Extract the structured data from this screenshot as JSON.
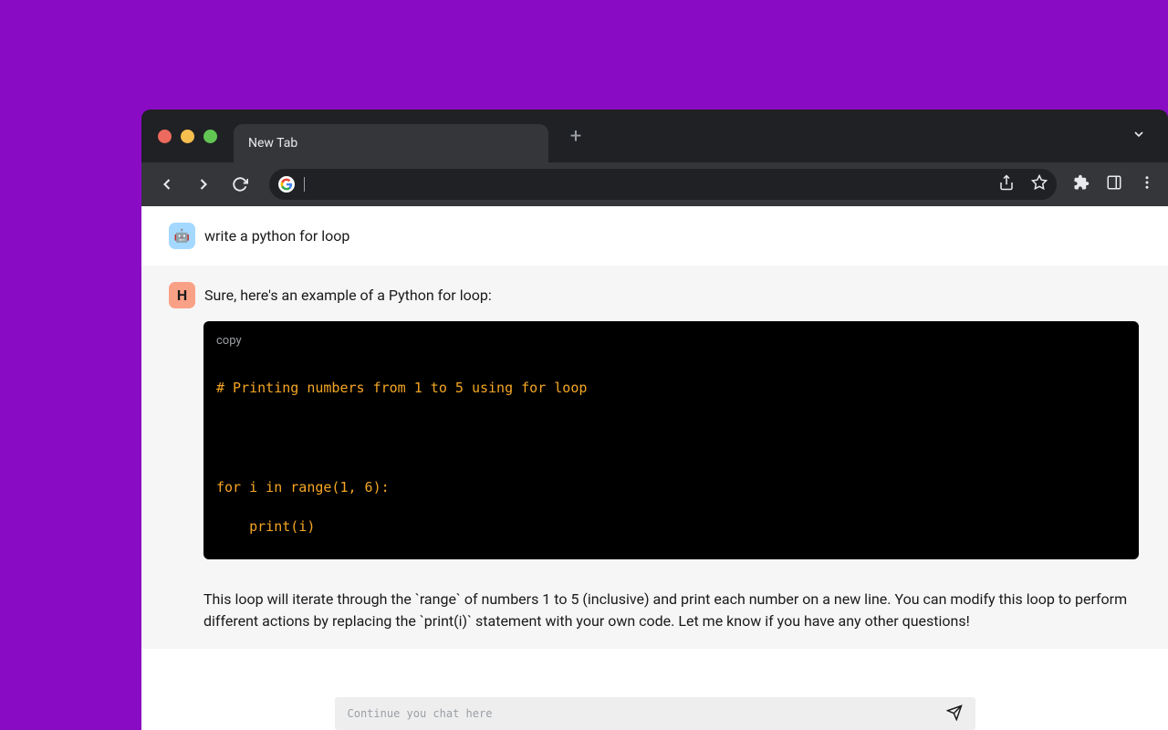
{
  "browser": {
    "tab_title": "New Tab"
  },
  "chat": {
    "user_message": "write a python for loop",
    "assistant_intro": "Sure, here's an example of a Python for loop:",
    "copy_label": "copy",
    "code_text": "# Printing numbers from 1 to 5 using for loop\n\n\n\n\nfor i in range(1, 6):\n\n    print(i)",
    "assistant_explain": "This loop will iterate through the `range` of numbers 1 to 5 (inclusive) and print each number on a new line. You can modify this loop to perform different actions by replacing the `print(i)` statement with your own code. Let me know if you have any other questions!",
    "assistant_avatar_letter": "H"
  },
  "input": {
    "placeholder": "Continue you chat here"
  }
}
